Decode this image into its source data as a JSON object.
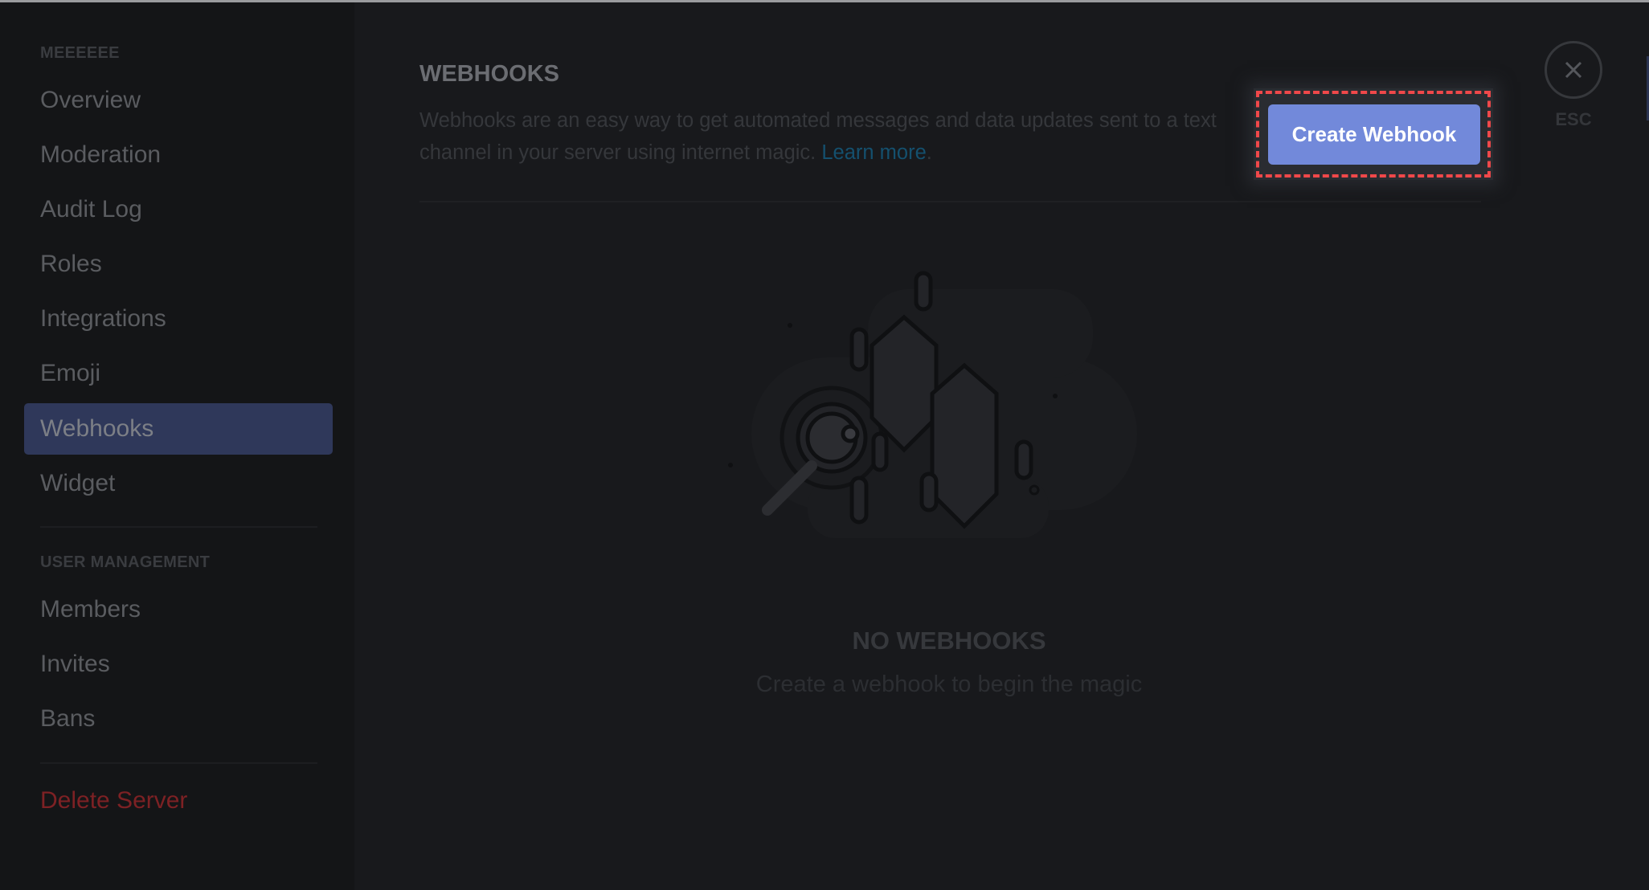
{
  "sidebar": {
    "server_section": "MEEEEEE",
    "server_items": [
      {
        "label": "Overview",
        "selected": false
      },
      {
        "label": "Moderation",
        "selected": false
      },
      {
        "label": "Audit Log",
        "selected": false
      },
      {
        "label": "Roles",
        "selected": false
      },
      {
        "label": "Integrations",
        "selected": false
      },
      {
        "label": "Emoji",
        "selected": false
      },
      {
        "label": "Webhooks",
        "selected": true
      },
      {
        "label": "Widget",
        "selected": false
      }
    ],
    "user_section": "USER MANAGEMENT",
    "user_items": [
      {
        "label": "Members"
      },
      {
        "label": "Invites"
      },
      {
        "label": "Bans"
      }
    ],
    "delete_label": "Delete Server"
  },
  "main": {
    "title": "WEBHOOKS",
    "description": "Webhooks are an easy way to get automated messages and data updates sent to a text channel in your server using internet magic.",
    "learn_more": "Learn more",
    "learn_more_suffix": ".",
    "create_button": "Create Webhook",
    "close_label": "ESC",
    "close_icon": "close-x-icon",
    "empty_title": "NO WEBHOOKS",
    "empty_subtitle": "Create a webhook to begin the magic"
  },
  "colors": {
    "accent": "#7289da",
    "selected_bg": "#2f385a",
    "danger": "#7d2124",
    "link": "#14506e",
    "highlight_dash": "#f0484a"
  }
}
